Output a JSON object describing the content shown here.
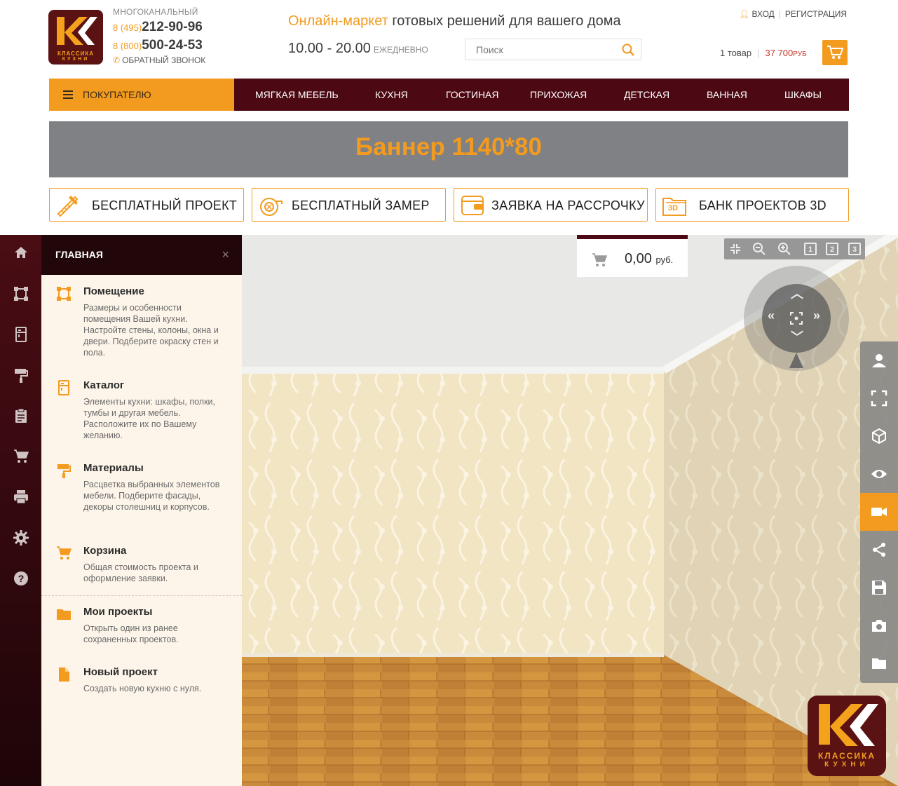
{
  "header": {
    "logo": {
      "line1": "КЛАССИКА",
      "line2": "КУХНИ"
    },
    "phones": {
      "caption": "МНОГОКАНАЛЬНЫЙ",
      "phone1_code": "8 (495)",
      "phone1_number": "212-90-96",
      "phone2_code": "8 (800)",
      "phone2_number": "500-24-53",
      "callback": "ОБРАТНЫЙ ЗВОНОК"
    },
    "slogan_accent": "Онлайн-маркет",
    "slogan_rest": " готовых решений для вашего дома",
    "hours": "10.00 - 20.00",
    "hours_note": "ЕЖЕДНЕВНО",
    "search_placeholder": "Поиск",
    "login": "ВХОД",
    "register": "РЕГИСТРАЦИЯ",
    "cart_count": "1 товар",
    "cart_sum": "37 700",
    "cart_currency": "РУБ",
    "accent_color": "#f39b1f",
    "nav_color": "#4c0913"
  },
  "nav": {
    "buyer": "ПОКУПАТЕЛЮ",
    "items": [
      "МЯГКАЯ МЕБЕЛЬ",
      "КУХНЯ",
      "ГОСТИНАЯ",
      "ПРИХОЖАЯ",
      "ДЕТСКАЯ",
      "ВАННАЯ",
      "ШКАФЫ"
    ]
  },
  "banner": {
    "text": "Баннер 1140*80"
  },
  "services": [
    {
      "label": "БЕСПЛАТНЫЙ ПРОЕКТ",
      "icon": "ruler-pencil-icon"
    },
    {
      "label": "БЕСПЛАТНЫЙ ЗАМЕР",
      "icon": "tape-measure-icon"
    },
    {
      "label": "ЗАЯВКА НА РАССРОЧКУ",
      "icon": "wallet-icon"
    },
    {
      "label": "БАНК ПРОЕКТОВ 3D",
      "icon": "folder-3d-icon",
      "badge": "3D"
    }
  ],
  "app": {
    "rail_icons": [
      "home-icon",
      "room-icon",
      "catalog-icon",
      "paint-roller-icon",
      "clipboard-icon",
      "cart-icon",
      "print-icon",
      "settings-icon",
      "help-icon"
    ],
    "panel": {
      "title": "ГЛАВНАЯ",
      "close": "×",
      "items": [
        {
          "title": "Помещение",
          "desc": "Размеры и особенности помещения Вашей кухни. Настройте стены, колоны, окна и двери. Подберите окраску стен и пола.",
          "icon": "room-icon"
        },
        {
          "title": "Каталог",
          "desc": "Элементы кухни: шкафы, полки, тумбы и другая мебель. Расположите их по Вашему желанию.",
          "icon": "catalog-icon"
        },
        {
          "title": "Материалы",
          "desc": "Расцветка выбранных элементов мебели. Подберите фасады, декоры столешниц и корпусов.",
          "icon": "paint-roller-icon"
        },
        {
          "title": "Корзина",
          "desc": "Общая стоимость проекта и оформление заявки.",
          "icon": "cart-icon"
        },
        {
          "title": "Мои проекты",
          "desc": "Открыть один из ранее сохраненных проектов.",
          "icon": "folder-icon"
        },
        {
          "title": "Новый проект",
          "desc": "Создать новую кухню с нуля.",
          "icon": "new-file-icon"
        }
      ]
    },
    "price": {
      "value": "0,00",
      "currency": "руб."
    },
    "zoombar": {
      "b1": "1",
      "b2": "2",
      "b3": "3"
    },
    "tools": [
      "user-icon",
      "fullscreen-icon",
      "cube-icon",
      "eye-icon",
      "camera-video-icon",
      "share-icon",
      "save-icon",
      "photo-camera-icon",
      "folder-icon"
    ],
    "active_tool": "camera-video-icon",
    "watermark": {
      "line1": "КЛАССИКА",
      "line2": "КУХНИ"
    }
  }
}
